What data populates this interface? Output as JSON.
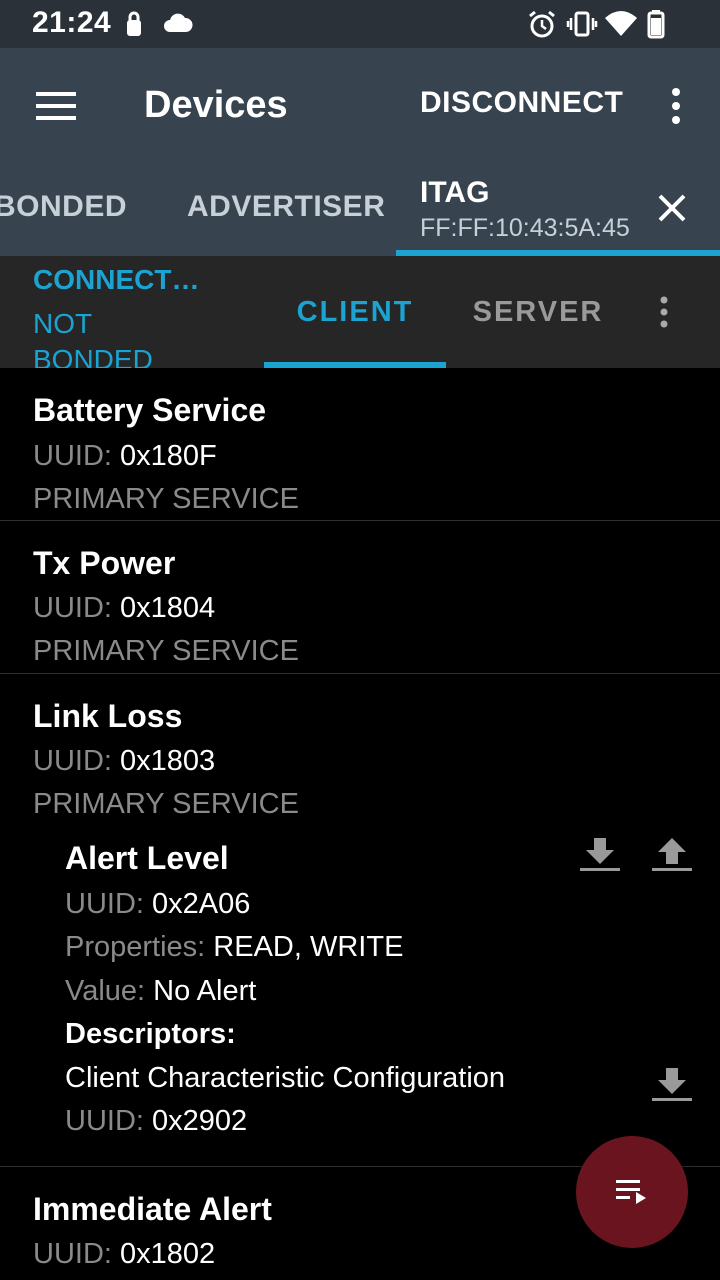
{
  "status_bar": {
    "time": "21:24",
    "left_icons": [
      "lock-icon",
      "cloud-icon"
    ],
    "right_icons": [
      "alarm-icon",
      "vibrate-icon",
      "wifi-icon",
      "battery-icon"
    ]
  },
  "app_bar": {
    "title": "Devices",
    "action": "DISCONNECT",
    "menu_icon": "hamburger-menu-icon",
    "overflow_icon": "more-vert-icon"
  },
  "device_tabs": [
    {
      "label": "BONDED"
    },
    {
      "label": "ADVERTISER"
    },
    {
      "label": "ITAG",
      "address": "FF:FF:10:43:5A:45",
      "selected": true
    }
  ],
  "connection": {
    "state": "CONNECT…",
    "bond": "NOT BONDED",
    "tabs": [
      {
        "label": "CLIENT",
        "selected": true
      },
      {
        "label": "SERVER",
        "selected": false
      }
    ]
  },
  "labels": {
    "uuid": "UUID:",
    "properties": "Properties:",
    "value": "Value:",
    "descriptors": "Descriptors:"
  },
  "services": [
    {
      "name": "Battery Service",
      "uuid": "0x180F",
      "type": "PRIMARY SERVICE"
    },
    {
      "name": "Tx Power",
      "uuid": "0x1804",
      "type": "PRIMARY SERVICE"
    },
    {
      "name": "Link Loss",
      "uuid": "0x1803",
      "type": "PRIMARY SERVICE",
      "characteristics": [
        {
          "name": "Alert Level",
          "uuid": "0x2A06",
          "properties": "READ, WRITE",
          "value": "No Alert",
          "descriptors": [
            {
              "name": "Client Characteristic Configuration",
              "uuid": "0x2902"
            }
          ]
        }
      ]
    },
    {
      "name": "Immediate Alert",
      "uuid": "0x1802"
    }
  ],
  "colors": {
    "accent": "#1ba3d1",
    "app_bar": "#37444f",
    "status_bar": "#2a3138",
    "fab": "#6a1420"
  }
}
